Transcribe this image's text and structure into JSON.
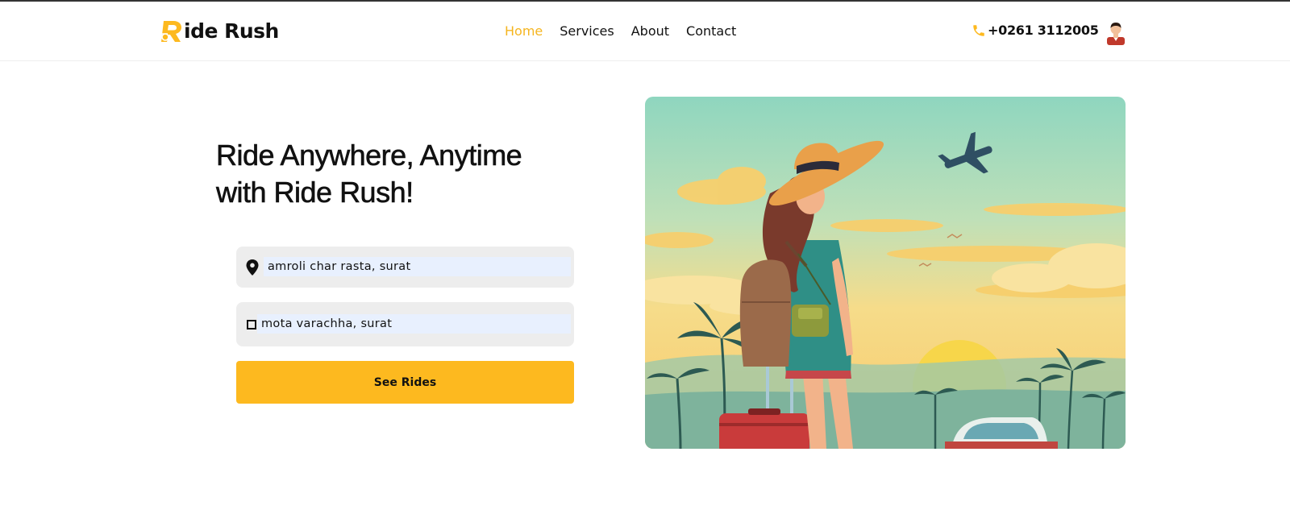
{
  "brand": {
    "logo_letter": "R",
    "name": "ide Rush",
    "accent_color": "#fdb91f"
  },
  "nav": {
    "items": [
      {
        "label": "Home",
        "active": true
      },
      {
        "label": "Services",
        "active": false
      },
      {
        "label": "About",
        "active": false
      },
      {
        "label": "Contact",
        "active": false
      }
    ]
  },
  "header": {
    "phone_icon": "phone-icon",
    "phone": "+0261 3112005",
    "avatar_icon": "user-avatar-icon"
  },
  "hero": {
    "title": "Ride Anywhere, Anytime with Ride Rush!",
    "pickup": {
      "icon": "map-pin-icon",
      "value": "amroli char rasta, surat"
    },
    "dropoff": {
      "icon": "square-stop-icon",
      "value": "mota varachha, surat"
    },
    "button_label": "See Rides",
    "illustration": "woman-traveler-beach-sunset-illustration"
  }
}
